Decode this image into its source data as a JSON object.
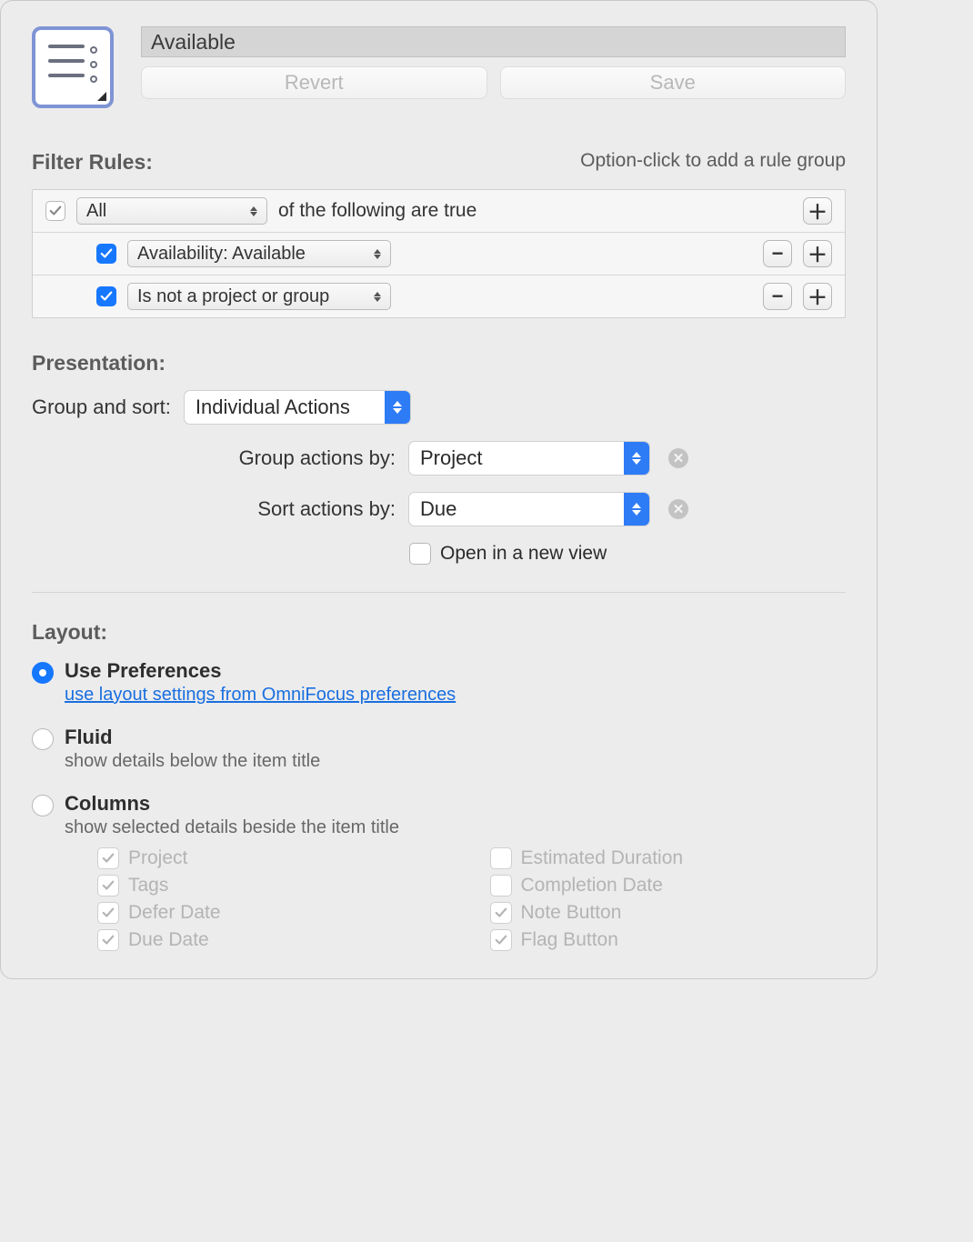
{
  "header": {
    "title": "Available",
    "revert_label": "Revert",
    "save_label": "Save"
  },
  "filter": {
    "heading": "Filter Rules:",
    "hint": "Option-click to add a rule group",
    "root_match": "All",
    "root_suffix": "of the following are true",
    "rules": [
      {
        "label": "Availability: Available"
      },
      {
        "label": "Is not a project or group"
      }
    ]
  },
  "presentation": {
    "heading": "Presentation:",
    "group_sort_label": "Group and sort:",
    "group_sort_value": "Individual Actions",
    "group_by_label": "Group actions by:",
    "group_by_value": "Project",
    "sort_by_label": "Sort actions by:",
    "sort_by_value": "Due",
    "open_new_view_label": "Open in a new view"
  },
  "layout": {
    "heading": "Layout:",
    "use_prefs_title": "Use Preferences",
    "use_prefs_link": "use layout settings from OmniFocus preferences",
    "fluid_title": "Fluid",
    "fluid_desc": "show details below the item title",
    "columns_title": "Columns",
    "columns_desc": "show selected details beside the item title",
    "columns": {
      "project": "Project",
      "tags": "Tags",
      "defer": "Defer Date",
      "due": "Due Date",
      "est": "Estimated Duration",
      "completion": "Completion Date",
      "note": "Note Button",
      "flag": "Flag Button"
    }
  }
}
